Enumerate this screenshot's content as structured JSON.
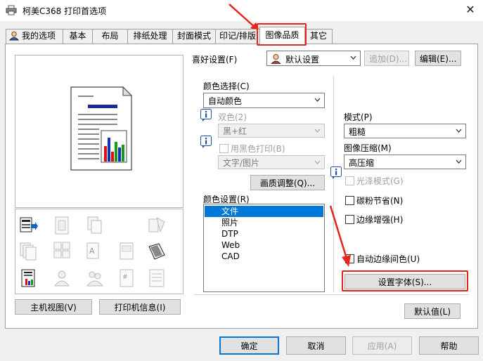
{
  "window": {
    "title": "柯美C368 打印首选项",
    "close_glyph": "✕"
  },
  "tabs": [
    {
      "label": "我的选项"
    },
    {
      "label": "基本"
    },
    {
      "label": "布局"
    },
    {
      "label": "排纸处理"
    },
    {
      "label": "封面模式"
    },
    {
      "label": "印记/排版"
    },
    {
      "label": "图像品质",
      "active": true
    },
    {
      "label": "其它"
    }
  ],
  "preview": {
    "host_view_button": "主机视图(V)",
    "printer_info_button": "打印机信息(I)"
  },
  "favorites": {
    "label": "喜好设置(F)",
    "value": "默认设置",
    "add_button": "追加(D)...",
    "edit_button": "编辑(E)..."
  },
  "color_select": {
    "label": "颜色选择(C)",
    "value": "自动颜色",
    "two_color_label": "双色(2)",
    "two_color_value": "黑+红",
    "black_print_label": "用黑色打印(B)",
    "black_print_value": "文字/图片",
    "quality_adjust_button": "画质调整(Q)..."
  },
  "color_setting": {
    "label": "颜色设置(R)",
    "items": [
      "文件",
      "照片",
      "DTP",
      "Web",
      "CAD"
    ],
    "selected_index": 0
  },
  "right": {
    "mode_label": "模式(P)",
    "mode_value": "粗糙",
    "compress_label": "图像压缩(M)",
    "compress_value": "高压缩",
    "gloss_label": "光泽模式(G)",
    "toner_save_label": "碳粉节省(N)",
    "edge_enhance_label": "边缘增强(H)",
    "auto_trap_label": "自动边缘间色(U)",
    "font_settings_button": "设置字体(S)...",
    "default_button": "默认值(L)"
  },
  "footer": {
    "ok_button": "确定",
    "cancel_button": "取消",
    "apply_button": "应用(A)",
    "help_button": "帮助"
  },
  "colors": {
    "accent": "#0078d7",
    "annotation_red": "#e8231b"
  }
}
